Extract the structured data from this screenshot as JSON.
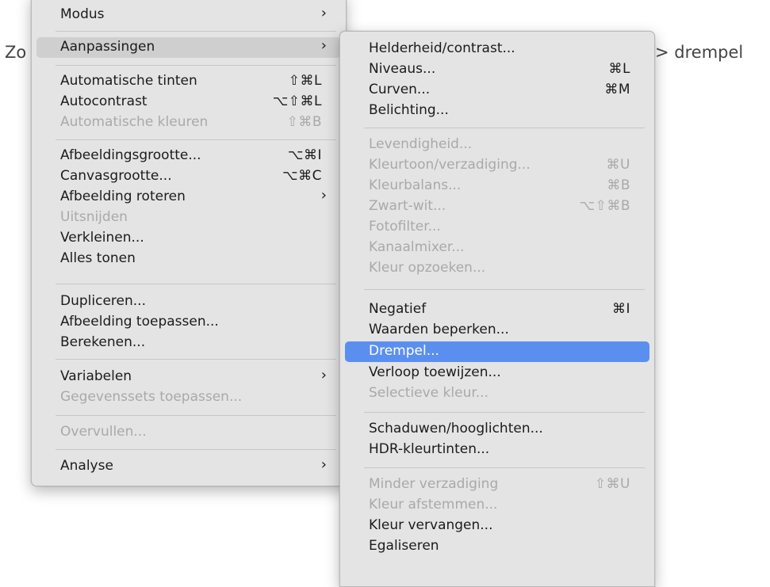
{
  "background": {
    "left_text": "Zo",
    "right_text": "> drempel"
  },
  "colors": {
    "menu_bg": "#e4e4e4",
    "highlight_blue": "#5a8ff0",
    "highlight_gray": "#cfcfcf",
    "disabled": "#a9a9a9"
  },
  "main_menu": {
    "items": [
      {
        "label": "Modus",
        "shortcut": "",
        "submenu": true,
        "disabled": false
      },
      {
        "label": "Aanpassingen",
        "shortcut": "",
        "submenu": true,
        "disabled": false,
        "highlighted": true
      },
      {
        "label": "Automatische tinten",
        "shortcut": "⇧⌘L",
        "submenu": false,
        "disabled": false
      },
      {
        "label": "Autocontrast",
        "shortcut": "⌥⇧⌘L",
        "submenu": false,
        "disabled": false
      },
      {
        "label": "Automatische kleuren",
        "shortcut": "⇧⌘B",
        "submenu": false,
        "disabled": true
      },
      {
        "label": "Afbeeldingsgrootte...",
        "shortcut": "⌥⌘I",
        "submenu": false,
        "disabled": false
      },
      {
        "label": "Canvasgrootte...",
        "shortcut": "⌥⌘C",
        "submenu": false,
        "disabled": false
      },
      {
        "label": "Afbeelding roteren",
        "shortcut": "",
        "submenu": true,
        "disabled": false
      },
      {
        "label": "Uitsnijden",
        "shortcut": "",
        "submenu": false,
        "disabled": true
      },
      {
        "label": "Verkleinen...",
        "shortcut": "",
        "submenu": false,
        "disabled": false
      },
      {
        "label": "Alles tonen",
        "shortcut": "",
        "submenu": false,
        "disabled": false
      },
      {
        "label": "Dupliceren...",
        "shortcut": "",
        "submenu": false,
        "disabled": false
      },
      {
        "label": "Afbeelding toepassen...",
        "shortcut": "",
        "submenu": false,
        "disabled": false
      },
      {
        "label": "Berekenen...",
        "shortcut": "",
        "submenu": false,
        "disabled": false
      },
      {
        "label": "Variabelen",
        "shortcut": "",
        "submenu": true,
        "disabled": false
      },
      {
        "label": "Gegevenssets toepassen...",
        "shortcut": "",
        "submenu": false,
        "disabled": true
      },
      {
        "label": "Overvullen...",
        "shortcut": "",
        "submenu": false,
        "disabled": true
      },
      {
        "label": "Analyse",
        "shortcut": "",
        "submenu": true,
        "disabled": false
      }
    ]
  },
  "sub_menu": {
    "items": [
      {
        "label": "Helderheid/contrast...",
        "shortcut": "",
        "disabled": false
      },
      {
        "label": "Niveaus...",
        "shortcut": "⌘L",
        "disabled": false
      },
      {
        "label": "Curven...",
        "shortcut": "⌘M",
        "disabled": false
      },
      {
        "label": "Belichting...",
        "shortcut": "",
        "disabled": false
      },
      {
        "label": "Levendigheid...",
        "shortcut": "",
        "disabled": true
      },
      {
        "label": "Kleurtoon/verzadiging...",
        "shortcut": "⌘U",
        "disabled": true
      },
      {
        "label": "Kleurbalans...",
        "shortcut": "⌘B",
        "disabled": true
      },
      {
        "label": "Zwart-wit...",
        "shortcut": "⌥⇧⌘B",
        "disabled": true
      },
      {
        "label": "Fotofilter...",
        "shortcut": "",
        "disabled": true
      },
      {
        "label": "Kanaalmixer...",
        "shortcut": "",
        "disabled": true
      },
      {
        "label": "Kleur opzoeken...",
        "shortcut": "",
        "disabled": true
      },
      {
        "label": "Negatief",
        "shortcut": "⌘I",
        "disabled": false
      },
      {
        "label": "Waarden beperken...",
        "shortcut": "",
        "disabled": false
      },
      {
        "label": "Drempel...",
        "shortcut": "",
        "disabled": false,
        "selected": true
      },
      {
        "label": "Verloop toewijzen...",
        "shortcut": "",
        "disabled": false
      },
      {
        "label": "Selectieve kleur...",
        "shortcut": "",
        "disabled": true
      },
      {
        "label": "Schaduwen/hooglichten...",
        "shortcut": "",
        "disabled": false
      },
      {
        "label": "HDR-kleurtinten...",
        "shortcut": "",
        "disabled": false
      },
      {
        "label": "Minder verzadiging",
        "shortcut": "⇧⌘U",
        "disabled": true
      },
      {
        "label": "Kleur afstemmen...",
        "shortcut": "",
        "disabled": true
      },
      {
        "label": "Kleur vervangen...",
        "shortcut": "",
        "disabled": false
      },
      {
        "label": "Egaliseren",
        "shortcut": "",
        "disabled": false
      }
    ]
  }
}
